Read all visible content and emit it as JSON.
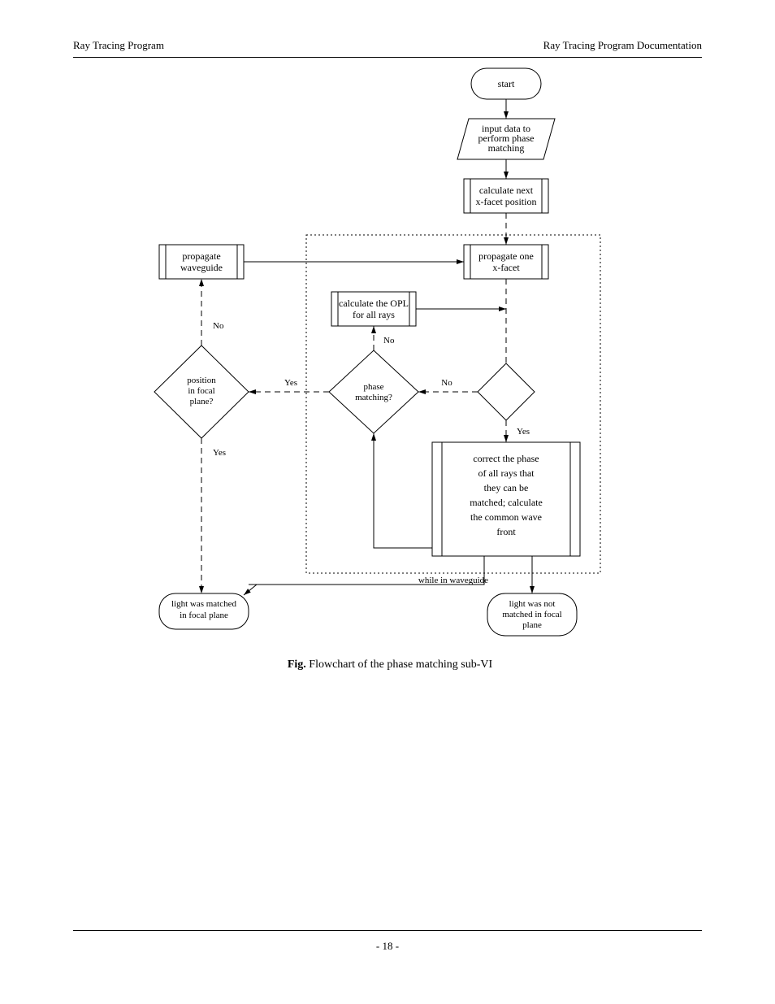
{
  "header": {
    "left": "Ray Tracing Program",
    "right": "Ray Tracing Program Documentation"
  },
  "pageNumber": "- 18 -",
  "caption": {
    "label": "Fig.",
    "text": " Flowchart of the phase matching sub-VI"
  },
  "fc": {
    "start": "start",
    "input": "input data to\nperform phase\nmatching",
    "calcFacet": "calculate next\nx-facet position",
    "propWg": "propagate\nwaveguide",
    "propFacet": "propagate one\nx-facet",
    "calcOpl": "calculate the OPL\nfor all rays",
    "diamondNo": "",
    "diamondPM": "phase\nmatching?",
    "diamondPos": "position\nin focal\nplane?",
    "noLabel": "No",
    "yesLabel": "Yes",
    "matchPlane": "light was matched\nin focal plane",
    "notMatch": "light was not\nmatched in focal\nplane",
    "corrAll": "correct the phase\nof all rays that\nthey can be\nmatched; calculate\nthe common wave\nfront",
    "dottedTitle": "while in waveguide"
  }
}
